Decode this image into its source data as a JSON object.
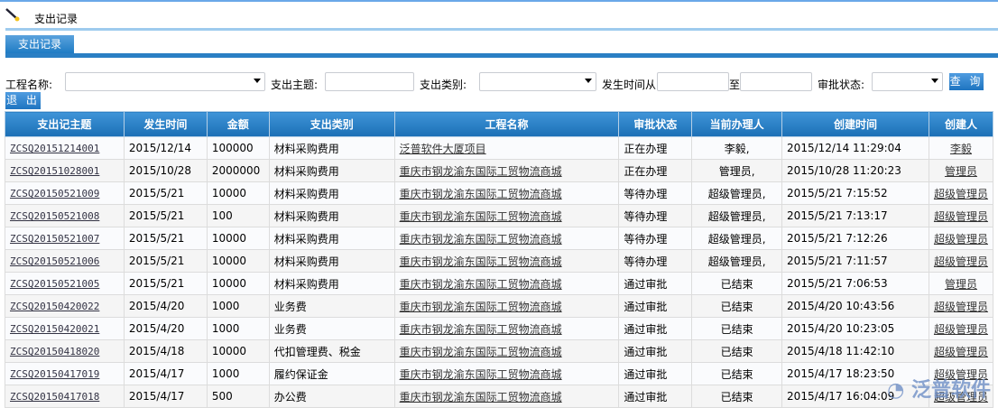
{
  "header": {
    "title": "支出记录",
    "tab": "支出记录"
  },
  "filters": {
    "project_label": "工程名称:",
    "subject_label": "支出主题:",
    "category_label": "支出类别:",
    "time_from_label": "发生时间从",
    "time_to_label": "至",
    "status_label": "审批状态:",
    "search_button": "查 询",
    "exit_button": "退 出"
  },
  "table": {
    "headers": [
      "支出记主题",
      "发生时间",
      "金额",
      "支出类别",
      "工程名称",
      "审批状态",
      "当前办理人",
      "创建时间",
      "创建人"
    ],
    "rows": [
      [
        "ZCSQ20151214001",
        "2015/12/14",
        "100000",
        "材料采购费用",
        "泛普软件大厦项目",
        "正在办理",
        "李毅,",
        "2015/12/14 11:29:04",
        "李毅"
      ],
      [
        "ZCSQ20151028001",
        "2015/10/28",
        "2000000",
        "材料采购费用",
        "重庆市钢龙渝东国际工贸物流商城",
        "正在办理",
        "管理员,",
        "2015/10/28 11:20:23",
        "管理员"
      ],
      [
        "ZCSQ20150521009",
        "2015/5/21",
        "10000",
        "材料采购费用",
        "重庆市钢龙渝东国际工贸物流商城",
        "等待办理",
        "超级管理员,",
        "2015/5/21 7:15:52",
        "超级管理员"
      ],
      [
        "ZCSQ20150521008",
        "2015/5/21",
        "100",
        "材料采购费用",
        "重庆市钢龙渝东国际工贸物流商城",
        "等待办理",
        "超级管理员,",
        "2015/5/21 7:13:17",
        "超级管理员"
      ],
      [
        "ZCSQ20150521007",
        "2015/5/21",
        "10000",
        "材料采购费用",
        "重庆市钢龙渝东国际工贸物流商城",
        "等待办理",
        "超级管理员,",
        "2015/5/21 7:12:26",
        "超级管理员"
      ],
      [
        "ZCSQ20150521006",
        "2015/5/21",
        "10000",
        "材料采购费用",
        "重庆市钢龙渝东国际工贸物流商城",
        "等待办理",
        "超级管理员,",
        "2015/5/21 7:11:57",
        "超级管理员"
      ],
      [
        "ZCSQ20150521005",
        "2015/5/21",
        "10000",
        "材料采购费用",
        "重庆市钢龙渝东国际工贸物流商城",
        "通过审批",
        "已结束",
        "2015/5/21 7:06:53",
        "管理员"
      ],
      [
        "ZCSQ20150420022",
        "2015/4/20",
        "1000",
        "业务费",
        "重庆市钢龙渝东国际工贸物流商城",
        "通过审批",
        "已结束",
        "2015/4/20 10:43:56",
        "超级管理员"
      ],
      [
        "ZCSQ20150420021",
        "2015/4/20",
        "1000",
        "业务费",
        "重庆市钢龙渝东国际工贸物流商城",
        "通过审批",
        "已结束",
        "2015/4/20 10:23:05",
        "超级管理员"
      ],
      [
        "ZCSQ20150418020",
        "2015/4/18",
        "10000",
        "代扣管理费、税金",
        "重庆市钢龙渝东国际工贸物流商城",
        "通过审批",
        "已结束",
        "2015/4/18 11:42:10",
        "超级管理员"
      ],
      [
        "ZCSQ20150417019",
        "2015/4/17",
        "1000",
        "履约保证金",
        "重庆市钢龙渝东国际工贸物流商城",
        "通过审批",
        "已结束",
        "2015/4/17 18:23:50",
        "超级管理员"
      ],
      [
        "ZCSQ20150417018",
        "2015/4/17",
        "500",
        "办公费",
        "重庆市钢龙渝东国际工贸物流商城",
        "通过审批",
        "已结束",
        "2015/4/17 16:04:09",
        "超级管理员"
      ]
    ]
  },
  "watermark": "泛普软件"
}
